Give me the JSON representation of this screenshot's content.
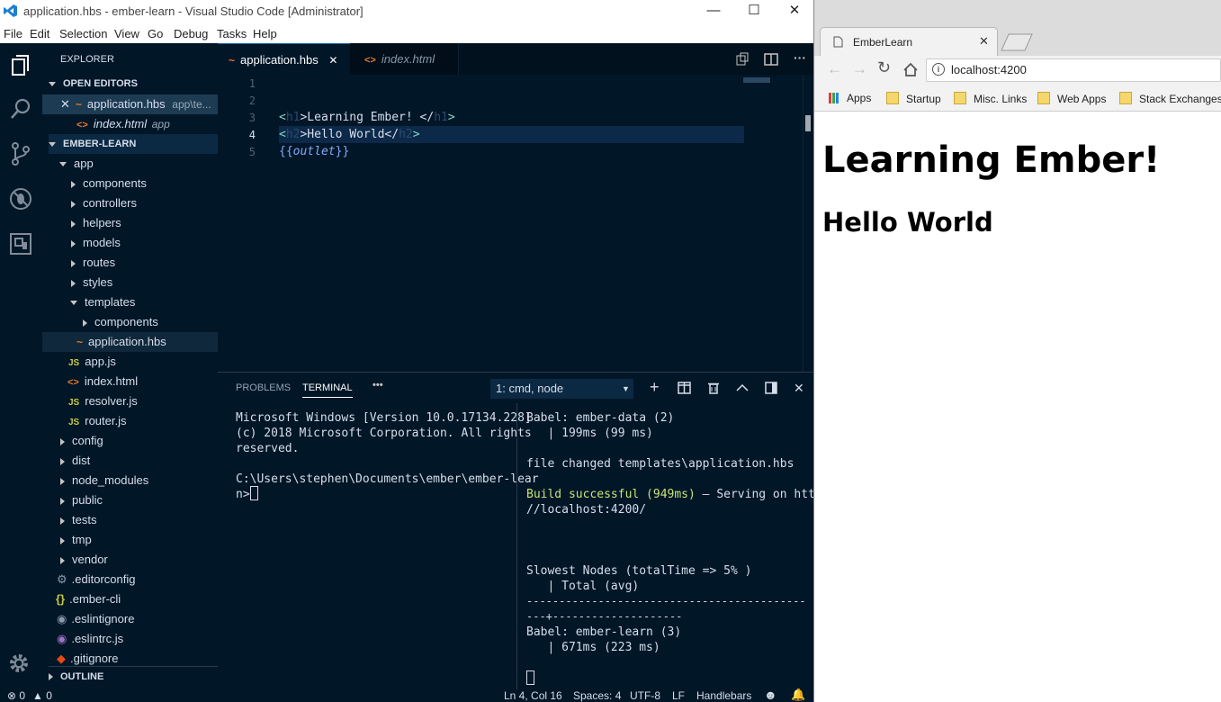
{
  "vscode": {
    "window_title": "application.hbs - ember-learn - Visual Studio Code [Administrator]",
    "menu": [
      "File",
      "Edit",
      "Selection",
      "View",
      "Go",
      "Debug",
      "Tasks",
      "Help"
    ],
    "explorer_title": "EXPLORER",
    "open_editors": {
      "title": "OPEN EDITORS",
      "items": [
        {
          "name": "application.hbs",
          "path": "app\\te..."
        },
        {
          "name": "index.html",
          "path": "app"
        }
      ]
    },
    "project": {
      "title": "EMBER-LEARN",
      "items": [
        "app",
        "components",
        "controllers",
        "helpers",
        "models",
        "routes",
        "styles",
        "templates",
        "components",
        "application.hbs",
        "app.js",
        "index.html",
        "resolver.js",
        "router.js",
        "config",
        "dist",
        "node_modules",
        "public",
        "tests",
        "tmp",
        "vendor",
        ".editorconfig",
        ".ember-cli",
        ".eslintignore",
        ".eslintrc.js",
        ".gitignore"
      ]
    },
    "outline_title": "OUTLINE",
    "tabs": [
      {
        "label": "application.hbs",
        "active": true
      },
      {
        "label": "index.html",
        "active": false
      }
    ],
    "editor": {
      "line_numbers": [
        "1",
        "2",
        "3",
        "4",
        "5"
      ],
      "lines": {
        "l3": {
          "open": "<",
          "tag1": "h1",
          "text": ">Learning Ember! </",
          "tag2": "h1",
          "close": ">"
        },
        "l4": {
          "open": "<",
          "tag1": "h2",
          "text": ">Hello World</",
          "tag2": "h2",
          "close": ">"
        },
        "l5": {
          "open": "{{",
          "kw": "outlet",
          "close": "}}"
        }
      }
    },
    "panel": {
      "tabs": [
        "PROBLEMS",
        "TERMINAL",
        "•••"
      ],
      "terminal_select": "1: cmd, node",
      "left_terminal": "Microsoft Windows [Version 10.0.17134.228]\n(c) 2018 Microsoft Corporation. All rights\nreserved.\n\nC:\\Users\\stephen\\Documents\\ember\\ember-lear\nn>",
      "right": {
        "l1": "Babel: ember-data (2)",
        "l2": "   | 199ms (99 ms)",
        "l3": "file changed templates\\application.hbs",
        "success": "Build successful (949ms)",
        "serving": " – Serving on http:",
        "l5": "//localhost:4200/",
        "l6": "Slowest Nodes (totalTime => 5% )",
        "l7": "   | Total (avg)",
        "l8": "-------------------------------------------",
        "l9": "---+--------------------",
        "l10": "Babel: ember-learn (3)",
        "l11": "   | 671ms (223 ms)"
      }
    },
    "status": {
      "errors": "0",
      "warnings": "0",
      "position": "Ln 4, Col 16",
      "spaces": "Spaces: 4",
      "encoding": "UTF-8",
      "eol": "LF",
      "language": "Handlebars"
    }
  },
  "browser": {
    "tab_title": "EmberLearn",
    "url": "localhost:4200",
    "bookmarks": [
      "Apps",
      "Startup",
      "Misc. Links",
      "Web Apps",
      "Stack Exchanges"
    ],
    "h1": "Learning Ember!",
    "h2": "Hello World"
  },
  "colors": {
    "accent_blue": "#1f5f9e",
    "tag": "#7fdbca",
    "success": "#c5e478"
  }
}
